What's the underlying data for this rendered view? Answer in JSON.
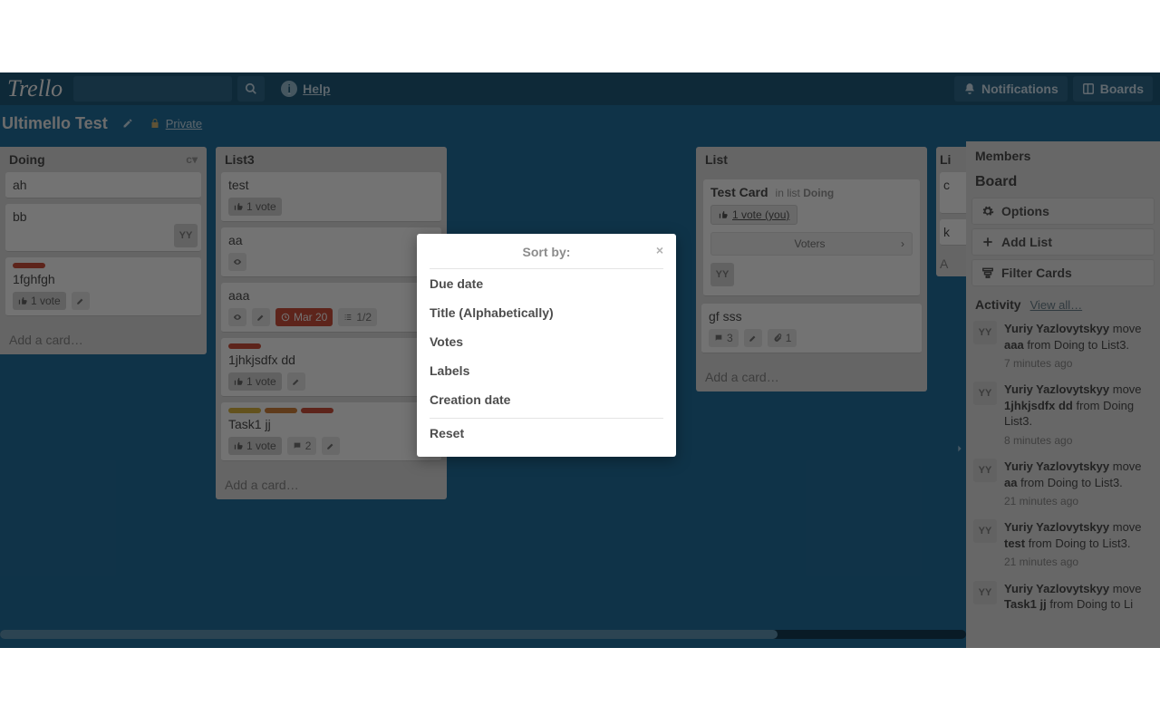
{
  "topbar": {
    "logo": "Trello",
    "help": "Help",
    "notifications": "Notifications",
    "boards": "Boards"
  },
  "board": {
    "title": "Ultimello Test",
    "privacy": "Private"
  },
  "lists": {
    "doing": {
      "title": "Doing",
      "menu": "c▾",
      "cards": {
        "c0": "ah",
        "c1": "bb",
        "c1_avatar": "YY",
        "c2": "1fghfgh",
        "c2_vote": "1 vote"
      },
      "add": "Add a card…"
    },
    "list3": {
      "title": "List3",
      "cards": {
        "c0": "test",
        "c0_vote": "1 vote",
        "c1": "aa",
        "c2": "aaa",
        "c2_due": "Mar 20",
        "c2_chk": "1/2",
        "c3": "1jhkjsdfx dd",
        "c3_vote": "1 vote",
        "c4": "Task1 jj",
        "c4_vote": "1 vote",
        "c4_comments": "2"
      },
      "add": "Add a card…"
    },
    "list": {
      "title": "List",
      "testcard": {
        "title": "Test Card",
        "inprefix": "in list",
        "inlist": "Doing",
        "vote": "1 vote (you)",
        "voters": "Voters",
        "av": "YY"
      },
      "c1": "gf sss",
      "c1_comments": "3",
      "c1_attach": "1",
      "add": "Add a card…"
    },
    "partial": {
      "title": "Li",
      "c0": "c",
      "c1": "k",
      "add": "A"
    }
  },
  "sidebar": {
    "members": "Members",
    "board": "Board",
    "options": "Options",
    "addlist": "Add List",
    "filter": "Filter Cards",
    "activity": "Activity",
    "viewall": "View all…",
    "items": [
      {
        "av": "YY",
        "actor": "Yuriy Yazlovytskyy",
        "verb": " move",
        "obj": "aaa",
        "rest": " from Doing to List3.",
        "ago": "7 minutes ago"
      },
      {
        "av": "YY",
        "actor": "Yuriy Yazlovytskyy",
        "verb": " move",
        "obj": "1jhkjsdfx dd",
        "rest": " from Doing List3.",
        "ago": "8 minutes ago"
      },
      {
        "av": "YY",
        "actor": "Yuriy Yazlovytskyy",
        "verb": " move",
        "obj": "aa",
        "rest": " from Doing to List3.",
        "ago": "21 minutes ago"
      },
      {
        "av": "YY",
        "actor": "Yuriy Yazlovytskyy",
        "verb": " move",
        "obj": "test",
        "rest": " from Doing to List3.",
        "ago": "21 minutes ago"
      },
      {
        "av": "YY",
        "actor": "Yuriy Yazlovytskyy",
        "verb": " move",
        "obj": "Task1 jj",
        "rest": " from Doing to Li",
        "ago": ""
      }
    ]
  },
  "popover": {
    "title": "Sort by:",
    "items": [
      "Due date",
      "Title (Alphabetically)",
      "Votes",
      "Labels",
      "Creation date"
    ],
    "reset": "Reset"
  }
}
